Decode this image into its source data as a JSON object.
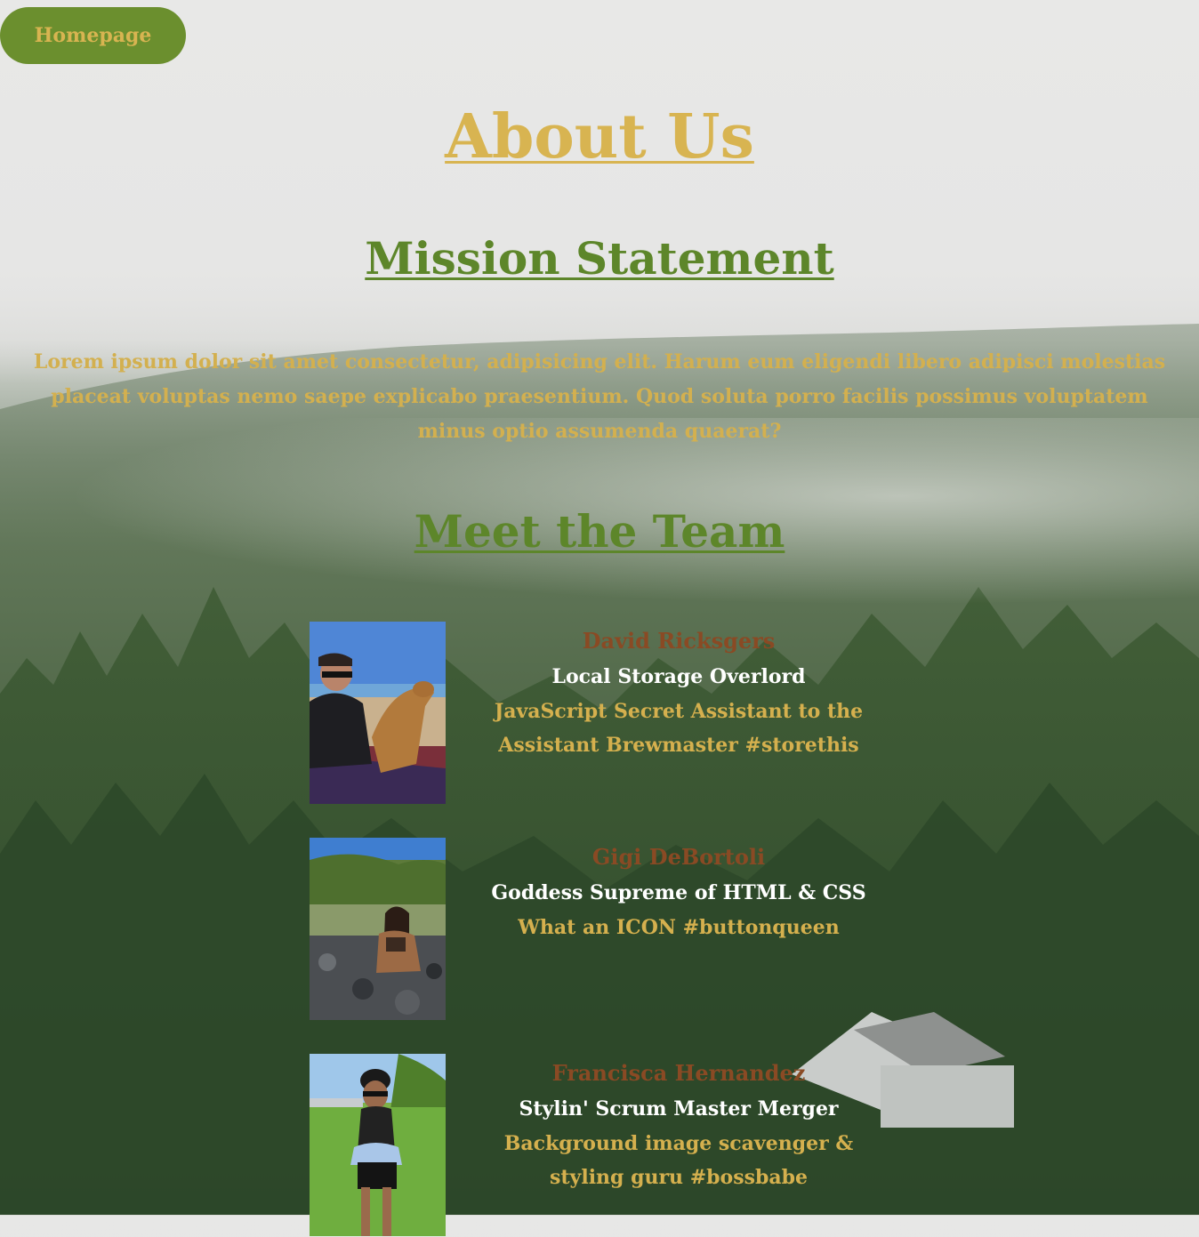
{
  "nav": {
    "home_label": "Homepage"
  },
  "page": {
    "title": "About Us"
  },
  "mission": {
    "heading": "Mission Statement",
    "text": "Lorem ipsum dolor sit amet consectetur, adipisicing elit. Harum eum eligendi libero adipisci molestias placeat voluptas nemo saepe explicabo praesentium. Quod soluta porro facilis possimus voluptatem minus optio assumenda quaerat?"
  },
  "team": {
    "heading": "Meet the Team",
    "members": [
      {
        "name": "David Ricksgers",
        "role": "Local Storage Overlord",
        "bio": "JavaScript Secret Assistant to the Assistant Brewmaster #storethis"
      },
      {
        "name": "Gigi DeBortoli",
        "role": "Goddess Supreme of HTML & CSS",
        "bio": "What an ICON #buttonqueen"
      },
      {
        "name": "Francisca Hernandez",
        "role": "Stylin' Scrum Master Merger",
        "bio": "Background image scavenger & styling guru #bossbabe"
      }
    ]
  },
  "colors": {
    "button_bg": "#6b8f2e",
    "gold": "#d8b451",
    "green": "#5d862a",
    "name_brown": "#8a4a24",
    "white": "#ffffff"
  }
}
